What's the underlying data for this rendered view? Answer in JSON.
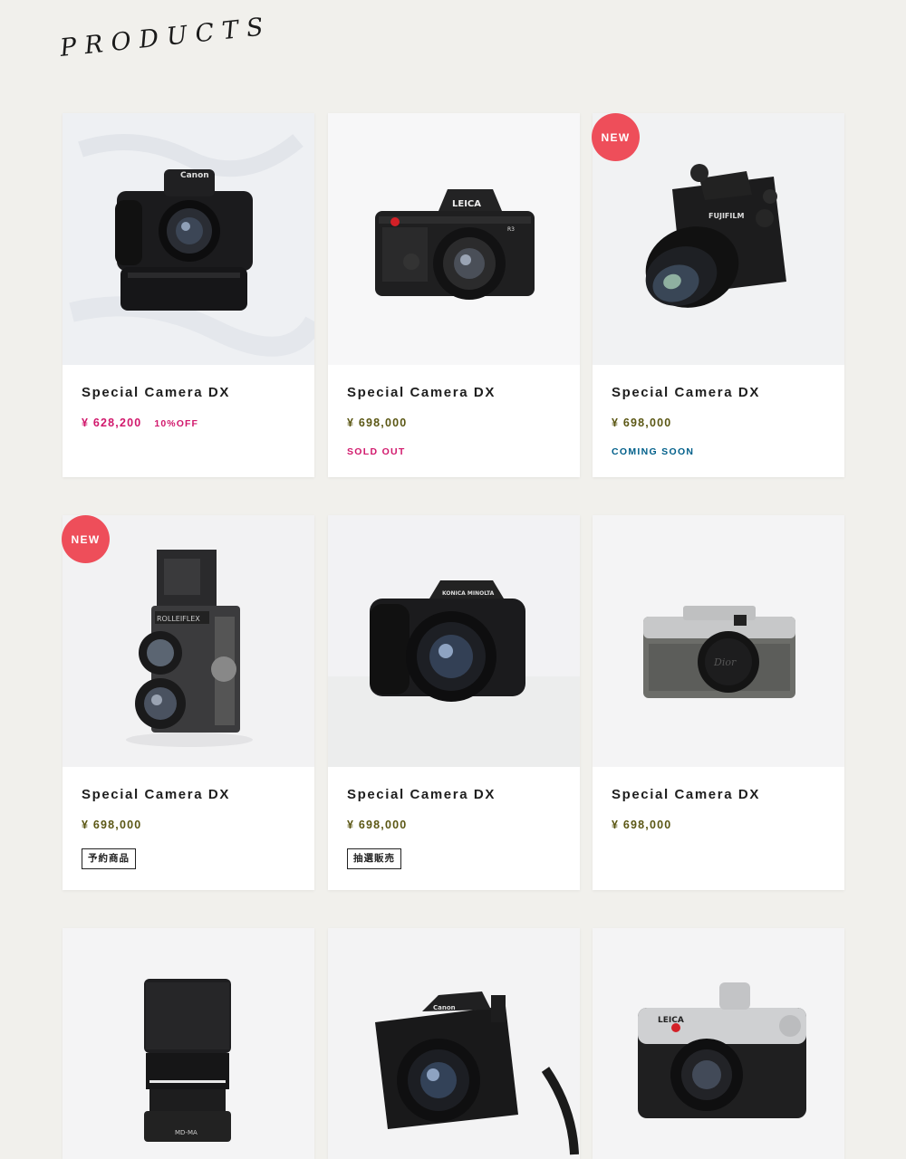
{
  "page": {
    "title": "PRODUCTS"
  },
  "colors": {
    "background": "#f1f0ec",
    "sale_price": "#d1186c",
    "price": "#5b5714",
    "sold_out": "#d1186c",
    "coming_soon": "#005f8a",
    "new_badge": "#ee4e5a"
  },
  "products": [
    {
      "name": "Special Camera DX",
      "price": "¥ 628,200",
      "discount": "10%OFF",
      "status": "",
      "tag": "",
      "badge": "",
      "image": "canon-dslr-battery-grip"
    },
    {
      "name": "Special Camera DX",
      "price": "¥ 698,000",
      "discount": "",
      "status": "SOLD OUT",
      "tag": "",
      "badge": "",
      "image": "leica-r3-slr"
    },
    {
      "name": "Special Camera DX",
      "price": "¥ 698,000",
      "discount": "",
      "status": "COMING SOON",
      "tag": "",
      "badge": "NEW",
      "image": "fujifilm-xt-mirrorless"
    },
    {
      "name": "Special Camera DX",
      "price": "¥ 698,000",
      "discount": "",
      "status": "",
      "tag": "予約商品",
      "badge": "NEW",
      "image": "rolleiflex-tlr"
    },
    {
      "name": "Special Camera DX",
      "price": "¥ 698,000",
      "discount": "",
      "status": "",
      "tag": "抽選販売",
      "badge": "",
      "image": "konica-minolta-dslr"
    },
    {
      "name": "Special Camera DX",
      "price": "¥ 698,000",
      "discount": "",
      "status": "",
      "tag": "",
      "badge": "",
      "image": "rangefinder-compact"
    },
    {
      "name": "",
      "price": "",
      "discount": "",
      "status": "",
      "tag": "",
      "badge": "",
      "image": "zoom-lens"
    },
    {
      "name": "",
      "price": "",
      "discount": "",
      "status": "",
      "tag": "",
      "badge": "",
      "image": "canon-bridge-camera"
    },
    {
      "name": "",
      "price": "",
      "discount": "",
      "status": "",
      "tag": "",
      "badge": "",
      "image": "leica-m6-rangefinder"
    }
  ]
}
